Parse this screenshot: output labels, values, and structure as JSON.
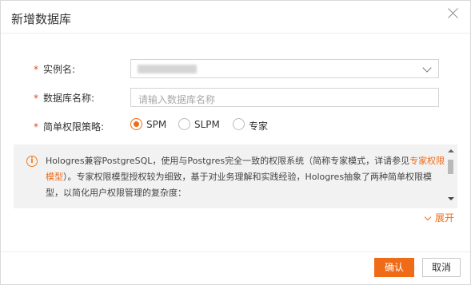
{
  "dialog": {
    "title": "新增数据库",
    "close_icon": "close-icon"
  },
  "form": {
    "required_mark": "*",
    "instance": {
      "label": "实例名:",
      "value": ""
    },
    "database_name": {
      "label": "数据库名称:",
      "value": "",
      "placeholder": "请输入数据库名称"
    },
    "permission_strategy": {
      "label": "简单权限策略:",
      "options": [
        "SPM",
        "SLPM",
        "专家"
      ],
      "selected": "SPM"
    }
  },
  "notice": {
    "icon": "info-icon",
    "text_before": "Hologres兼容PostgreSQL，使用与Postgres完全一致的权限系统（简称专家模式，详请参见",
    "link_text": "专家权限模型",
    "text_after": "）。专家权限模型授权较为细致，基于对业务理解和实践经验，Hologres抽象了两种简单权限模型，以简化用户权限管理的复杂度：",
    "expand_label": "展开"
  },
  "footer": {
    "confirm_label": "确认",
    "cancel_label": "取消"
  },
  "colors": {
    "accent": "#f06b17",
    "required": "#e14a20"
  }
}
